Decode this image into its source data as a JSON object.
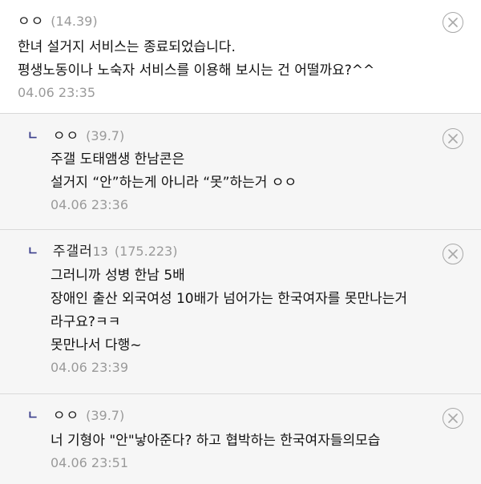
{
  "comments": [
    {
      "is_reply": false,
      "nickname": "ㅇㅇ",
      "nick_number": "",
      "ip": "(14.39)",
      "lines": [
        "한녀 설거지 서비스는 종료되었습니다.",
        "평생노동이나 노숙자 서비스를 이용해 보시는 건 어떨까요?^^"
      ],
      "date": "04.06 23:35"
    },
    {
      "is_reply": true,
      "reply_marker": "ㄴ",
      "nickname": "ㅇㅇ",
      "nick_number": "",
      "ip": "(39.7)",
      "lines": [
        "주갤 도태앰생 한남콘은",
        "설거지 “안”하는게 아니라 “못”하는거 ㅇㅇ"
      ],
      "date": "04.06 23:36"
    },
    {
      "is_reply": true,
      "reply_marker": "ㄴ",
      "nickname": "주갤러",
      "nick_number": "13",
      "ip": "(175.223)",
      "lines": [
        "그러니까 성병 한남 5배",
        "장애인 출산 외국여성 10배가 넘어가는 한국여자를 못만나는거",
        "라구요?ㅋㅋ",
        "못만나서 다행~"
      ],
      "date": "04.06 23:39"
    },
    {
      "is_reply": true,
      "reply_marker": "ㄴ",
      "nickname": "ㅇㅇ",
      "nick_number": "",
      "ip": "(39.7)",
      "lines": [
        "너 기형아 \"안\"낳아준다? 하고 협박하는 한국여자들의모습"
      ],
      "date": "04.06 23:51"
    }
  ],
  "icons": {
    "delete": "close-circle-icon"
  },
  "colors": {
    "reply_bg": "#f6f6f6",
    "reply_marker": "#3b3f8c",
    "meta_gray": "#9a9a9a"
  }
}
